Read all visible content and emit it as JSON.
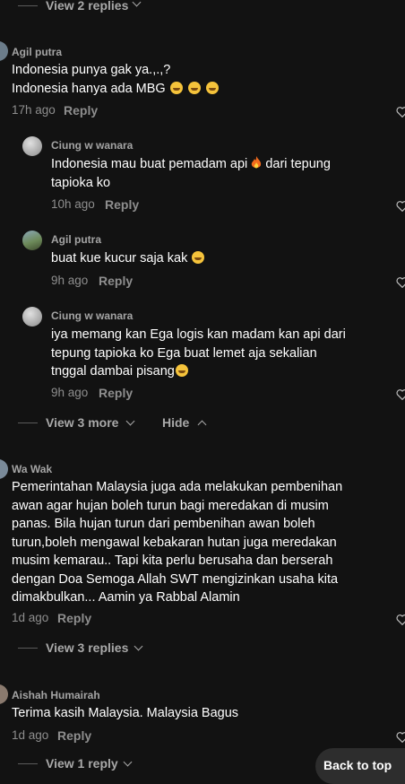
{
  "top_thread": {
    "view_replies": "View 2 replies"
  },
  "comments": [
    {
      "author": "Agil putra",
      "text_l1": "Indonesia punya gak ya.,.,?",
      "text_l2": "Indonesia hanya ada MBG",
      "time": "17h ago",
      "reply": "Reply",
      "replies": [
        {
          "author": "Ciung w wanara",
          "text_l1": "Indonesia mau buat pemadam api",
          "text_l1b": "dari tepung",
          "text_l2": "tapioka ko",
          "time": "10h ago",
          "reply": "Reply"
        },
        {
          "author": "Agil putra",
          "text_l1": "buat kue kucur saja kak",
          "time": "9h ago",
          "reply": "Reply"
        },
        {
          "author": "Ciung w wanara",
          "text_l1": "iya memang kan Ega logis kan madam kan api dari",
          "text_l2": "tepung tapioka ko Ega buat lemet aja sekalian",
          "text_l3": "tnggal dambai pisang",
          "time": "9h ago",
          "reply": "Reply"
        }
      ],
      "view_more": "View 3 more",
      "hide": "Hide"
    },
    {
      "author": "Wa Wak",
      "text_lines": [
        "Pemerintahan Malaysia juga ada melakukan pembenihan",
        "awan agar hujan boleh turun bagi meredakan di musim",
        "panas. Bila hujan turun dari pembenihan awan boleh",
        "turun,boleh mengawal kebakaran hutan juga meredakan",
        "musim kemarau.. Tapi kita perlu berusaha dan berserah",
        "dengan Doa Semoga Allah SWT mengizinkan usaha kita",
        "dimakbulkan... Aamin ya Rabbal Alamin"
      ],
      "time": "1d ago",
      "reply": "Reply",
      "view_replies": "View 3 replies"
    },
    {
      "author": "Aishah Humairah",
      "text_l1": "Terima kasih Malaysia. Malaysia Bagus",
      "time": "1d ago",
      "reply": "Reply",
      "view_replies": "View 1 reply"
    }
  ],
  "back_to_top": "Back to top",
  "icons": {
    "heart": "heart-outline-icon",
    "chevron_down": "chevron-down-icon",
    "chevron_up": "chevron-up-icon"
  }
}
